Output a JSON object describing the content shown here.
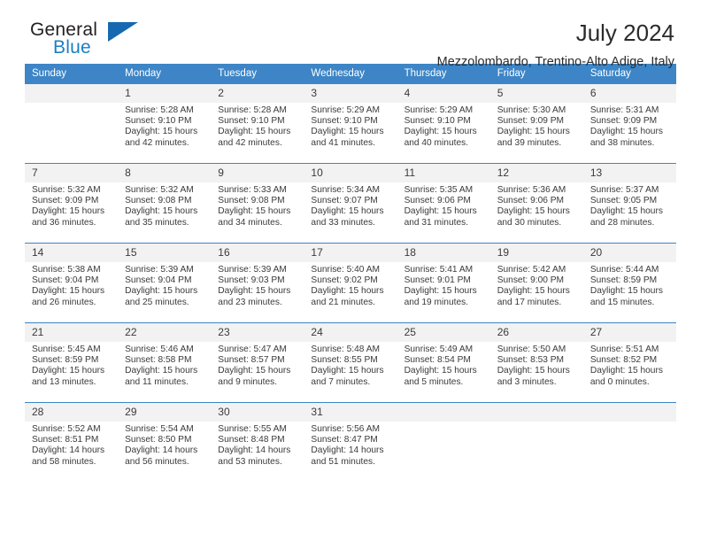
{
  "brand": {
    "word_one": "General",
    "word_two": "Blue",
    "logo_icon": "triangle-logo-icon",
    "accent_color": "#1668b0"
  },
  "header": {
    "title": "July 2024",
    "subtitle": "Mezzolombardo, Trentino-Alto Adige, Italy"
  },
  "calendar": {
    "header_bg": "#3d85c6",
    "daynum_bg": "#f2f2f2",
    "weekday_labels": [
      "Sunday",
      "Monday",
      "Tuesday",
      "Wednesday",
      "Thursday",
      "Friday",
      "Saturday"
    ],
    "weeks": [
      [
        {
          "day": "",
          "text": ""
        },
        {
          "day": "1",
          "text": "Sunrise: 5:28 AM\nSunset: 9:10 PM\nDaylight: 15 hours\nand 42 minutes."
        },
        {
          "day": "2",
          "text": "Sunrise: 5:28 AM\nSunset: 9:10 PM\nDaylight: 15 hours\nand 42 minutes."
        },
        {
          "day": "3",
          "text": "Sunrise: 5:29 AM\nSunset: 9:10 PM\nDaylight: 15 hours\nand 41 minutes."
        },
        {
          "day": "4",
          "text": "Sunrise: 5:29 AM\nSunset: 9:10 PM\nDaylight: 15 hours\nand 40 minutes."
        },
        {
          "day": "5",
          "text": "Sunrise: 5:30 AM\nSunset: 9:09 PM\nDaylight: 15 hours\nand 39 minutes."
        },
        {
          "day": "6",
          "text": "Sunrise: 5:31 AM\nSunset: 9:09 PM\nDaylight: 15 hours\nand 38 minutes."
        }
      ],
      [
        {
          "day": "7",
          "text": "Sunrise: 5:32 AM\nSunset: 9:09 PM\nDaylight: 15 hours\nand 36 minutes."
        },
        {
          "day": "8",
          "text": "Sunrise: 5:32 AM\nSunset: 9:08 PM\nDaylight: 15 hours\nand 35 minutes."
        },
        {
          "day": "9",
          "text": "Sunrise: 5:33 AM\nSunset: 9:08 PM\nDaylight: 15 hours\nand 34 minutes."
        },
        {
          "day": "10",
          "text": "Sunrise: 5:34 AM\nSunset: 9:07 PM\nDaylight: 15 hours\nand 33 minutes."
        },
        {
          "day": "11",
          "text": "Sunrise: 5:35 AM\nSunset: 9:06 PM\nDaylight: 15 hours\nand 31 minutes."
        },
        {
          "day": "12",
          "text": "Sunrise: 5:36 AM\nSunset: 9:06 PM\nDaylight: 15 hours\nand 30 minutes."
        },
        {
          "day": "13",
          "text": "Sunrise: 5:37 AM\nSunset: 9:05 PM\nDaylight: 15 hours\nand 28 minutes."
        }
      ],
      [
        {
          "day": "14",
          "text": "Sunrise: 5:38 AM\nSunset: 9:04 PM\nDaylight: 15 hours\nand 26 minutes."
        },
        {
          "day": "15",
          "text": "Sunrise: 5:39 AM\nSunset: 9:04 PM\nDaylight: 15 hours\nand 25 minutes."
        },
        {
          "day": "16",
          "text": "Sunrise: 5:39 AM\nSunset: 9:03 PM\nDaylight: 15 hours\nand 23 minutes."
        },
        {
          "day": "17",
          "text": "Sunrise: 5:40 AM\nSunset: 9:02 PM\nDaylight: 15 hours\nand 21 minutes."
        },
        {
          "day": "18",
          "text": "Sunrise: 5:41 AM\nSunset: 9:01 PM\nDaylight: 15 hours\nand 19 minutes."
        },
        {
          "day": "19",
          "text": "Sunrise: 5:42 AM\nSunset: 9:00 PM\nDaylight: 15 hours\nand 17 minutes."
        },
        {
          "day": "20",
          "text": "Sunrise: 5:44 AM\nSunset: 8:59 PM\nDaylight: 15 hours\nand 15 minutes."
        }
      ],
      [
        {
          "day": "21",
          "text": "Sunrise: 5:45 AM\nSunset: 8:59 PM\nDaylight: 15 hours\nand 13 minutes."
        },
        {
          "day": "22",
          "text": "Sunrise: 5:46 AM\nSunset: 8:58 PM\nDaylight: 15 hours\nand 11 minutes."
        },
        {
          "day": "23",
          "text": "Sunrise: 5:47 AM\nSunset: 8:57 PM\nDaylight: 15 hours\nand 9 minutes."
        },
        {
          "day": "24",
          "text": "Sunrise: 5:48 AM\nSunset: 8:55 PM\nDaylight: 15 hours\nand 7 minutes."
        },
        {
          "day": "25",
          "text": "Sunrise: 5:49 AM\nSunset: 8:54 PM\nDaylight: 15 hours\nand 5 minutes."
        },
        {
          "day": "26",
          "text": "Sunrise: 5:50 AM\nSunset: 8:53 PM\nDaylight: 15 hours\nand 3 minutes."
        },
        {
          "day": "27",
          "text": "Sunrise: 5:51 AM\nSunset: 8:52 PM\nDaylight: 15 hours\nand 0 minutes."
        }
      ],
      [
        {
          "day": "28",
          "text": "Sunrise: 5:52 AM\nSunset: 8:51 PM\nDaylight: 14 hours\nand 58 minutes."
        },
        {
          "day": "29",
          "text": "Sunrise: 5:54 AM\nSunset: 8:50 PM\nDaylight: 14 hours\nand 56 minutes."
        },
        {
          "day": "30",
          "text": "Sunrise: 5:55 AM\nSunset: 8:48 PM\nDaylight: 14 hours\nand 53 minutes."
        },
        {
          "day": "31",
          "text": "Sunrise: 5:56 AM\nSunset: 8:47 PM\nDaylight: 14 hours\nand 51 minutes."
        },
        {
          "day": "",
          "text": ""
        },
        {
          "day": "",
          "text": ""
        },
        {
          "day": "",
          "text": ""
        }
      ]
    ]
  }
}
